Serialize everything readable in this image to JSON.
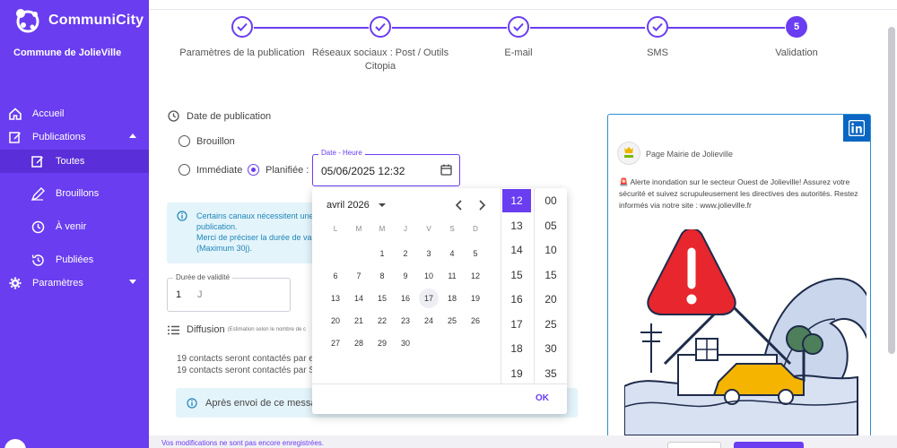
{
  "app": {
    "name": "CommuniCity",
    "commune": "Commune de JolieVille"
  },
  "sidebar": {
    "items": [
      {
        "label": "Accueil"
      },
      {
        "label": "Publications"
      },
      {
        "label": "Toutes"
      },
      {
        "label": "Brouillons"
      },
      {
        "label": "À venir"
      },
      {
        "label": "Publiées"
      },
      {
        "label": "Paramètres"
      }
    ]
  },
  "stepper": {
    "steps": [
      {
        "label": "Paramètres de la publication",
        "status": "done"
      },
      {
        "label": "Réseaux sociaux : Post / Outils Citopia",
        "status": "done"
      },
      {
        "label": "E-mail",
        "status": "done"
      },
      {
        "label": "SMS",
        "status": "done"
      },
      {
        "label": "Validation",
        "status": "current",
        "number": "5"
      }
    ]
  },
  "form": {
    "date_section_label": "Date de publication",
    "options": {
      "brouillon": "Brouillon",
      "immediate": "Immédiate",
      "planned": "Planifiée :"
    },
    "selected_option": "planned",
    "datetime": {
      "legend": "Date - Heure",
      "value": "05/06/2025 12:32"
    },
    "info": {
      "text": "Certains canaux nécessitent une\npublication.\nMerci de préciser la durée de va\n(Maximum 30j)."
    },
    "duration": {
      "legend": "Durée de validité",
      "value": "1",
      "suffix": "J"
    },
    "diffusion": {
      "label": "Diffusion",
      "note": "(Estimation selon le nombre de c"
    },
    "contacts": [
      "19 contacts seront contactés par e",
      "19 contacts seront contactés par S"
    ],
    "after_send": "Après envoi de ce messag"
  },
  "picker": {
    "month": "avril 2026",
    "weekdays": [
      "L",
      "M",
      "M",
      "J",
      "V",
      "S",
      "D"
    ],
    "weeks": [
      [
        "",
        "",
        "1",
        "2",
        "3",
        "4",
        "5"
      ],
      [
        "6",
        "7",
        "8",
        "9",
        "10",
        "11",
        "12"
      ],
      [
        "13",
        "14",
        "15",
        "16",
        "17",
        "18",
        "19"
      ],
      [
        "20",
        "21",
        "22",
        "23",
        "24",
        "25",
        "26"
      ],
      [
        "27",
        "28",
        "29",
        "30",
        "",
        "",
        ""
      ]
    ],
    "today": "17",
    "hours": [
      "12",
      "13",
      "14",
      "15",
      "16",
      "17",
      "18",
      "19"
    ],
    "selected_hour": "12",
    "minutes": [
      "00",
      "05",
      "10",
      "15",
      "20",
      "25",
      "30",
      "35"
    ],
    "ok_label": "OK"
  },
  "preview": {
    "network": "linkedin",
    "page_name": "Page Mairie de Jolieville",
    "post_text": "🚨 Alerte inondation sur le secteur Ouest de Jolieville! Assurez votre sécurité et suivez scrupuleusement les directives des autorités. Restez informés via notre site : www.jolieville.fr"
  },
  "footer": {
    "unsaved": "Vos modifications ne sont pas encore enregistrées."
  },
  "colors": {
    "primary": "#6a3df0",
    "info_text": "#1f86b8",
    "info_bg": "#e4f4fb",
    "linkedin": "#0a66c2"
  }
}
